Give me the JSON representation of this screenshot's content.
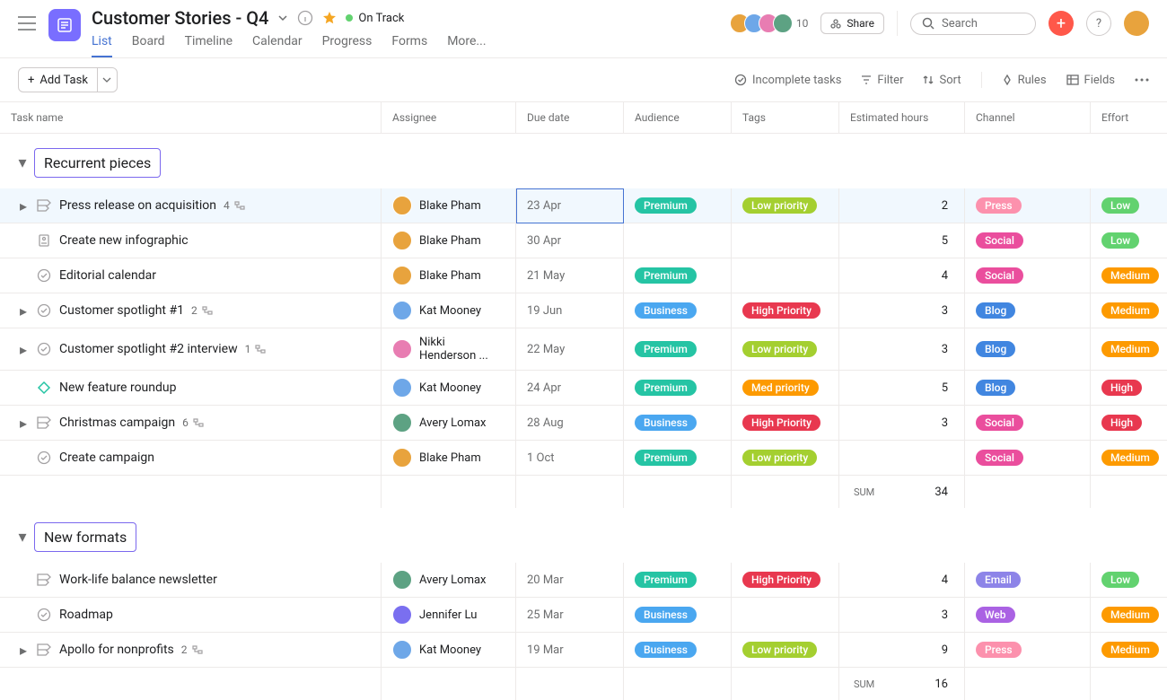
{
  "header": {
    "title": "Customer Stories - Q4",
    "status": "On Track",
    "member_count": "10",
    "share_label": "Share",
    "search_placeholder": "Search"
  },
  "tabs": [
    "List",
    "Board",
    "Timeline",
    "Calendar",
    "Progress",
    "Forms",
    "More..."
  ],
  "toolbar": {
    "add_task": "Add Task",
    "incomplete": "Incomplete tasks",
    "filter": "Filter",
    "sort": "Sort",
    "rules": "Rules",
    "fields": "Fields"
  },
  "columns": [
    "Task name",
    "Assignee",
    "Due date",
    "Audience",
    "Tags",
    "Estimated hours",
    "Channel",
    "Effort"
  ],
  "sections": [
    {
      "name": "Recurrent pieces",
      "sum_label": "SUM",
      "sum_value": "34",
      "tasks": [
        {
          "name": "Press release on acquisition",
          "icon": "milestone",
          "expand": true,
          "sub": "4",
          "assignee": "Blake Pham",
          "av": "c1",
          "due": "23 Apr",
          "selected": true,
          "audience": {
            "t": "Premium",
            "c": "premium"
          },
          "tag": {
            "t": "Low priority",
            "c": "low-pri"
          },
          "hours": "2",
          "channel": {
            "t": "Press",
            "c": "press"
          },
          "effort": {
            "t": "Low",
            "c": "low"
          }
        },
        {
          "name": "Create new infographic",
          "icon": "form",
          "assignee": "Blake Pham",
          "av": "c1",
          "due": "30 Apr",
          "audience": null,
          "tag": null,
          "hours": "5",
          "channel": {
            "t": "Social",
            "c": "social"
          },
          "effort": {
            "t": "Low",
            "c": "low"
          }
        },
        {
          "name": "Editorial calendar",
          "icon": "check",
          "assignee": "Blake Pham",
          "av": "c1",
          "due": "21 May",
          "audience": {
            "t": "Premium",
            "c": "premium"
          },
          "tag": null,
          "hours": "4",
          "channel": {
            "t": "Social",
            "c": "social"
          },
          "effort": {
            "t": "Medium",
            "c": "medium"
          }
        },
        {
          "name": "Customer spotlight #1",
          "icon": "check",
          "expand": true,
          "sub": "2",
          "assignee": "Kat Mooney",
          "av": "c2",
          "due": "19 Jun",
          "audience": {
            "t": "Business",
            "c": "business"
          },
          "tag": {
            "t": "High Priority",
            "c": "high-pri"
          },
          "hours": "3",
          "channel": {
            "t": "Blog",
            "c": "blog"
          },
          "effort": {
            "t": "Medium",
            "c": "medium"
          }
        },
        {
          "name": "Customer spotlight #2 interview",
          "icon": "check",
          "expand": true,
          "sub": "1",
          "assignee": "Nikki Henderson ...",
          "av": "c3",
          "due": "22 May",
          "audience": {
            "t": "Premium",
            "c": "premium"
          },
          "tag": {
            "t": "Low priority",
            "c": "low-pri"
          },
          "hours": "3",
          "channel": {
            "t": "Blog",
            "c": "blog"
          },
          "effort": {
            "t": "Medium",
            "c": "medium"
          }
        },
        {
          "name": "New feature roundup",
          "icon": "diamond",
          "assignee": "Kat Mooney",
          "av": "c2",
          "due": "24 Apr",
          "audience": {
            "t": "Premium",
            "c": "premium"
          },
          "tag": {
            "t": "Med priority",
            "c": "med-pri"
          },
          "hours": "5",
          "channel": {
            "t": "Blog",
            "c": "blog"
          },
          "effort": {
            "t": "High",
            "c": "high"
          }
        },
        {
          "name": "Christmas campaign",
          "icon": "milestone",
          "expand": true,
          "sub": "6",
          "assignee": "Avery Lomax",
          "av": "c4",
          "due": "28 Aug",
          "audience": {
            "t": "Business",
            "c": "business"
          },
          "tag": {
            "t": "High Priority",
            "c": "high-pri"
          },
          "hours": "3",
          "channel": {
            "t": "Social",
            "c": "social"
          },
          "effort": {
            "t": "High",
            "c": "high"
          }
        },
        {
          "name": "Create campaign",
          "icon": "check",
          "assignee": "Blake Pham",
          "av": "c1",
          "due": "1 Oct",
          "audience": {
            "t": "Premium",
            "c": "premium"
          },
          "tag": {
            "t": "Low priority",
            "c": "low-pri"
          },
          "hours": "",
          "channel": {
            "t": "Social",
            "c": "social"
          },
          "effort": {
            "t": "Medium",
            "c": "medium"
          }
        }
      ]
    },
    {
      "name": "New formats",
      "sum_label": "SUM",
      "sum_value": "16",
      "tasks": [
        {
          "name": "Work-life balance newsletter",
          "icon": "milestone",
          "assignee": "Avery Lomax",
          "av": "c4",
          "due": "20 Mar",
          "audience": {
            "t": "Premium",
            "c": "premium"
          },
          "tag": {
            "t": "High Priority",
            "c": "high-pri"
          },
          "hours": "4",
          "channel": {
            "t": "Email",
            "c": "email"
          },
          "effort": {
            "t": "Low",
            "c": "low"
          }
        },
        {
          "name": "Roadmap",
          "icon": "check",
          "assignee": "Jennifer Lu",
          "av": "c5",
          "due": "25 Mar",
          "audience": {
            "t": "Business",
            "c": "business"
          },
          "tag": null,
          "hours": "3",
          "channel": {
            "t": "Web",
            "c": "web"
          },
          "effort": {
            "t": "Medium",
            "c": "medium"
          }
        },
        {
          "name": "Apollo for nonprofits",
          "icon": "milestone",
          "expand": true,
          "sub": "2",
          "assignee": "Kat Mooney",
          "av": "c2",
          "due": "19 Mar",
          "audience": {
            "t": "Business",
            "c": "business"
          },
          "tag": {
            "t": "Low priority",
            "c": "low-pri"
          },
          "hours": "9",
          "channel": {
            "t": "Press",
            "c": "press"
          },
          "effort": {
            "t": "Medium",
            "c": "medium"
          }
        }
      ]
    }
  ]
}
